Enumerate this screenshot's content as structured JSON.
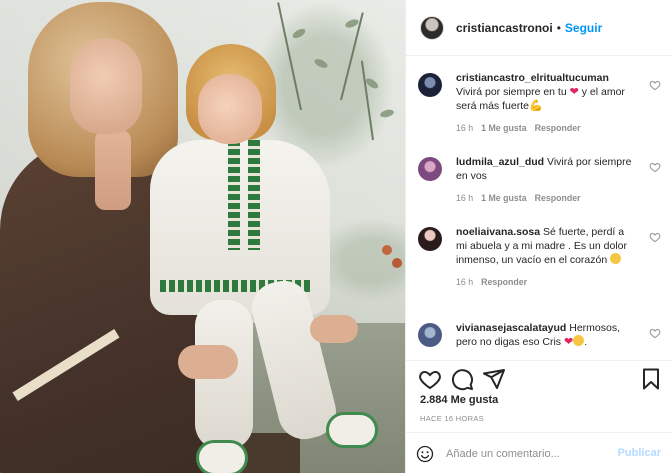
{
  "post": {
    "username": "cristiancastronoi",
    "separator": "•",
    "follow_label": "Seguir"
  },
  "comments": [
    {
      "username": "cristiancastro_elritualtucuman",
      "text_a": "Vivirá por siempre en tu ",
      "text_b": " y el amor será más fuerte",
      "time": "16 h",
      "likes": "1 Me gusta",
      "reply": "Responder"
    },
    {
      "username": "ludmila_azul_dud",
      "text": "Vivirá por siempre en vos",
      "time": "16 h",
      "likes": "1 Me gusta",
      "reply": "Responder"
    },
    {
      "username": "noeliaivana.sosa",
      "text": "Sé fuerte, perdí a mi abuela y a mi madre . Es un dolor inmenso, un vacío en el corazón ",
      "time": "16 h",
      "reply": "Responder"
    },
    {
      "username": "vivianasejascalatayud",
      "text": "Hermosos, pero no digas eso Cris ",
      "text_end": "."
    }
  ],
  "stats": {
    "likes": "2.884 Me gusta",
    "time_ago": "HACE 16 HORAS"
  },
  "composer": {
    "placeholder": "Añade un comentario...",
    "publish_label": "Publicar"
  },
  "colors": {
    "accent": "#0095f6",
    "publish_disabled": "#b3dbff",
    "muted_text": "#8e8e8e",
    "heart_emoji": "#e0245e"
  },
  "icons": {
    "like": "heart-outline-icon",
    "comment": "speech-bubble-icon",
    "share": "paper-plane-icon",
    "save": "bookmark-icon",
    "emoji": "smiley-icon"
  }
}
